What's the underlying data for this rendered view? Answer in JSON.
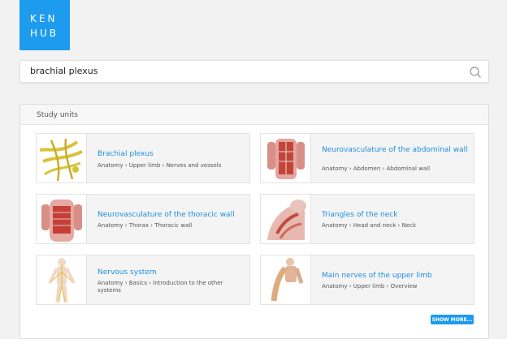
{
  "logo": {
    "line1": "KEN",
    "line2": "HUB"
  },
  "search": {
    "value": "brachial plexus",
    "icon": "search-icon"
  },
  "study_units": {
    "title": "Study units",
    "cards": [
      {
        "title": "Brachial plexus",
        "path": "Anatomy › Upper limb › Nerves and vessels"
      },
      {
        "title": "Neurovasculature of the abdominal wall",
        "path": "Anatomy › Abdomen › Abdominal wall"
      },
      {
        "title": "Neurovasculature of the thoracic wall",
        "path": "Anatomy › Thorax › Thoracic wall"
      },
      {
        "title": "Triangles of the neck",
        "path": "Anatomy › Head and neck › Neck"
      },
      {
        "title": "Nervous system",
        "path": "Anatomy › Basics › Introduction to the other systems"
      },
      {
        "title": "Main nerves of the upper limb",
        "path": "Anatomy › Upper limb › Overview"
      }
    ],
    "show_more": "SHOW MORE..."
  },
  "colors": {
    "accent": "#1d9bef",
    "link": "#1d8fe0",
    "background": "#f2f2f2"
  }
}
